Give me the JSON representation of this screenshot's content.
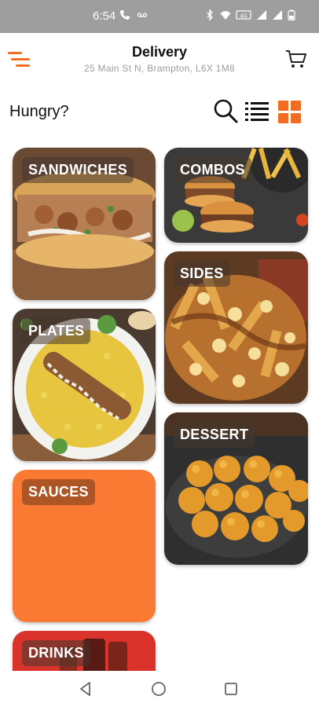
{
  "status_bar": {
    "time": "6:54",
    "left_icons": [
      "phone-icon",
      "voicemail-icon"
    ],
    "right_icons": [
      "bluetooth-icon",
      "wifi-icon",
      "volte-icon",
      "signal-icon",
      "signal-icon",
      "battery-icon"
    ]
  },
  "header": {
    "title": "Delivery",
    "address": "25 Main St N, Brampton, L6X 1M8"
  },
  "heading": "Hungry?",
  "view_controls": [
    "search-icon",
    "list-view-icon",
    "grid-view-icon"
  ],
  "categories": [
    {
      "label": "SANDWICHES"
    },
    {
      "label": "COMBOS"
    },
    {
      "label": "SIDES"
    },
    {
      "label": "PLATES"
    },
    {
      "label": "DESSERT"
    },
    {
      "label": "SAUCES"
    },
    {
      "label": "DRINKS"
    }
  ],
  "colors": {
    "accent": "#f26d21",
    "sauces_tile": "#fb7a33",
    "drinks_tile": "#d9332b",
    "status_bar": "#9e9e9e"
  },
  "nav": [
    "back-icon",
    "home-icon",
    "recents-icon"
  ]
}
